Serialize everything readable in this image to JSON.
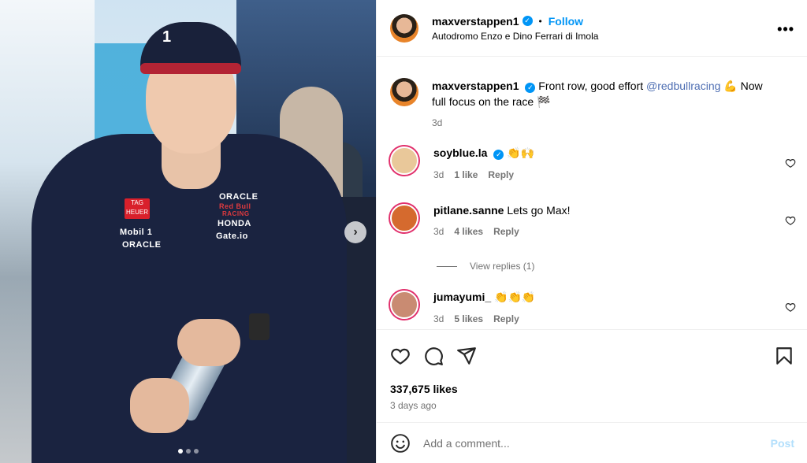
{
  "post": {
    "username": "maxverstappen1",
    "follow_label": "Follow",
    "separator": "•",
    "location": "Autodromo Enzo e Dino Ferrari di Imola",
    "more_icon": "more-horizontal-icon",
    "carousel_dots": 3,
    "carousel_active_index": 0
  },
  "caption": {
    "username": "maxverstappen1",
    "text_before": "Front row, good effort ",
    "mention": "@redbullracing",
    "text_after": " 💪 Now full focus on the race 🏁",
    "time": "3d"
  },
  "comments": [
    {
      "username": "soyblue.la",
      "verified": true,
      "text": "👏🙌",
      "time": "3d",
      "likes": "1 like",
      "reply": "Reply",
      "avatar_color": "#e9c89a"
    },
    {
      "username": "pitlane.sanne",
      "verified": false,
      "text": "Lets go Max!",
      "time": "3d",
      "likes": "4 likes",
      "reply": "Reply",
      "avatar_color": "#d56a2e"
    },
    {
      "username": "jumayumi_",
      "verified": false,
      "text": "👏👏👏",
      "time": "3d",
      "likes": "5 likes",
      "reply": "Reply",
      "avatar_color": "#c98b72"
    }
  ],
  "view_replies": "View replies (1)",
  "actions": {
    "like_icon": "heart-icon",
    "comment_icon": "comment-icon",
    "share_icon": "share-icon",
    "save_icon": "bookmark-icon"
  },
  "likes": "337,675 likes",
  "post_date": "3 days ago",
  "add_comment": {
    "placeholder": "Add a comment...",
    "post_label": "Post"
  },
  "photo": {
    "cap_number": "1",
    "sponsors": [
      "ORACLE",
      "Red Bull",
      "RACING",
      "HONDA",
      "Gate.io",
      "Mobil 1",
      "ORACLE"
    ],
    "tag_label": "TAG HEUER"
  }
}
